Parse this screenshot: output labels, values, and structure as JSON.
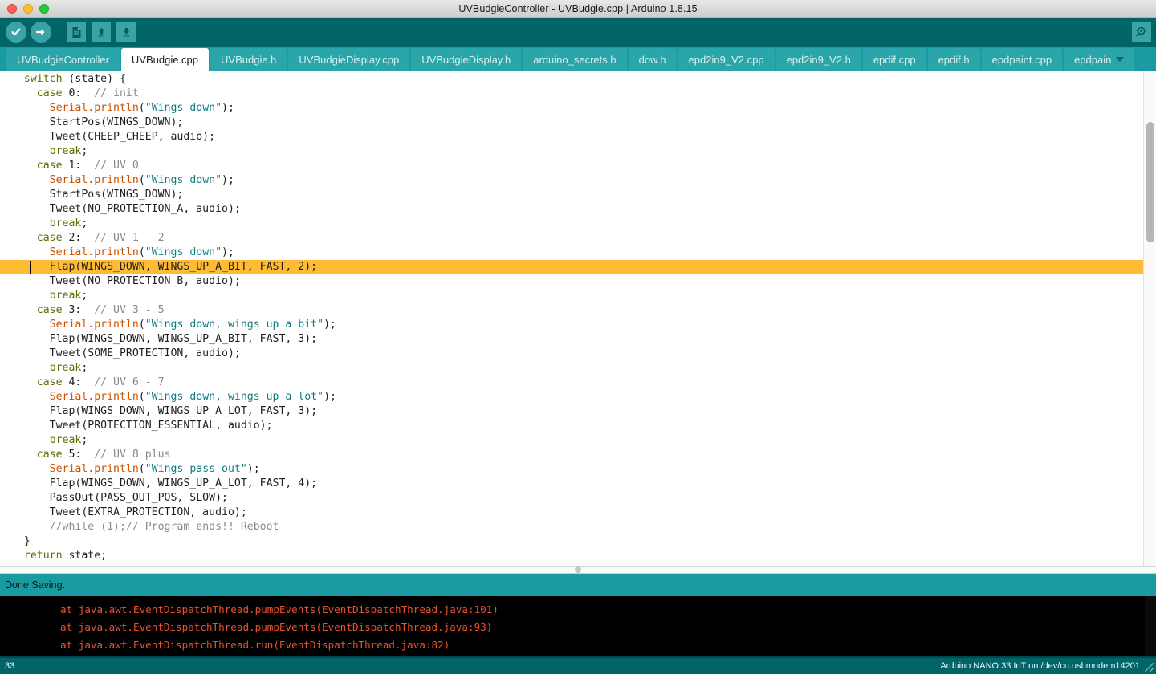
{
  "window": {
    "title": "UVBudgieController - UVBudgie.cpp | Arduino 1.8.15",
    "close_label": "",
    "minimize_label": "",
    "maximize_label": ""
  },
  "toolbar": {
    "verify_label": "Verify",
    "upload_label": "Upload",
    "new_label": "New",
    "open_label": "Open",
    "save_label": "Save",
    "serial_monitor_label": "Serial Monitor"
  },
  "tabs": {
    "active_index": 1,
    "items": [
      {
        "label": "UVBudgieController"
      },
      {
        "label": "UVBudgie.cpp"
      },
      {
        "label": "UVBudgie.h"
      },
      {
        "label": "UVBudgieDisplay.cpp"
      },
      {
        "label": "UVBudgieDisplay.h"
      },
      {
        "label": "arduino_secrets.h"
      },
      {
        "label": "dow.h"
      },
      {
        "label": "epd2in9_V2.cpp"
      },
      {
        "label": "epd2in9_V2.h"
      },
      {
        "label": "epdif.cpp"
      },
      {
        "label": "epdif.h"
      },
      {
        "label": "epdpaint.cpp"
      },
      {
        "label": "epdpain"
      }
    ]
  },
  "editor": {
    "highlighted_line_index": 13,
    "lines": [
      [
        {
          "t": "  ",
          "c": "plain"
        },
        {
          "t": "switch",
          "c": "kw"
        },
        {
          "t": " (state) {",
          "c": "plain"
        }
      ],
      [
        {
          "t": "    ",
          "c": "plain"
        },
        {
          "t": "case",
          "c": "kw"
        },
        {
          "t": " 0:  ",
          "c": "plain"
        },
        {
          "t": "// init",
          "c": "com"
        }
      ],
      [
        {
          "t": "      ",
          "c": "plain"
        },
        {
          "t": "Serial.println",
          "c": "fn"
        },
        {
          "t": "(",
          "c": "plain"
        },
        {
          "t": "\"Wings down\"",
          "c": "str"
        },
        {
          "t": ");",
          "c": "plain"
        }
      ],
      [
        {
          "t": "      StartPos(WINGS_DOWN);",
          "c": "plain"
        }
      ],
      [
        {
          "t": "      Tweet(CHEEP_CHEEP, audio);",
          "c": "plain"
        }
      ],
      [
        {
          "t": "      ",
          "c": "plain"
        },
        {
          "t": "break",
          "c": "kw"
        },
        {
          "t": ";",
          "c": "plain"
        }
      ],
      [
        {
          "t": "    ",
          "c": "plain"
        },
        {
          "t": "case",
          "c": "kw"
        },
        {
          "t": " 1:  ",
          "c": "plain"
        },
        {
          "t": "// UV 0",
          "c": "com"
        }
      ],
      [
        {
          "t": "      ",
          "c": "plain"
        },
        {
          "t": "Serial.println",
          "c": "fn"
        },
        {
          "t": "(",
          "c": "plain"
        },
        {
          "t": "\"Wings down\"",
          "c": "str"
        },
        {
          "t": ");",
          "c": "plain"
        }
      ],
      [
        {
          "t": "      StartPos(WINGS_DOWN);",
          "c": "plain"
        }
      ],
      [
        {
          "t": "      Tweet(NO_PROTECTION_A, audio);",
          "c": "plain"
        }
      ],
      [
        {
          "t": "      ",
          "c": "plain"
        },
        {
          "t": "break",
          "c": "kw"
        },
        {
          "t": ";",
          "c": "plain"
        }
      ],
      [
        {
          "t": "    ",
          "c": "plain"
        },
        {
          "t": "case",
          "c": "kw"
        },
        {
          "t": " 2:  ",
          "c": "plain"
        },
        {
          "t": "// UV 1 - 2",
          "c": "com"
        }
      ],
      [
        {
          "t": "      ",
          "c": "plain"
        },
        {
          "t": "Serial.println",
          "c": "fn"
        },
        {
          "t": "(",
          "c": "plain"
        },
        {
          "t": "\"Wings down\"",
          "c": "str"
        },
        {
          "t": ");",
          "c": "plain"
        }
      ],
      [
        {
          "t": "      Flap(WINGS_DOWN, WINGS_UP_A_BIT, FAST, 2);",
          "c": "plain"
        }
      ],
      [
        {
          "t": "      Tweet(NO_PROTECTION_B, audio);",
          "c": "plain"
        }
      ],
      [
        {
          "t": "      ",
          "c": "plain"
        },
        {
          "t": "break",
          "c": "kw"
        },
        {
          "t": ";",
          "c": "plain"
        }
      ],
      [
        {
          "t": "    ",
          "c": "plain"
        },
        {
          "t": "case",
          "c": "kw"
        },
        {
          "t": " 3:  ",
          "c": "plain"
        },
        {
          "t": "// UV 3 - 5",
          "c": "com"
        }
      ],
      [
        {
          "t": "      ",
          "c": "plain"
        },
        {
          "t": "Serial.println",
          "c": "fn"
        },
        {
          "t": "(",
          "c": "plain"
        },
        {
          "t": "\"Wings down, wings up a bit\"",
          "c": "str"
        },
        {
          "t": ");",
          "c": "plain"
        }
      ],
      [
        {
          "t": "      Flap(WINGS_DOWN, WINGS_UP_A_BIT, FAST, 3);",
          "c": "plain"
        }
      ],
      [
        {
          "t": "      Tweet(SOME_PROTECTION, audio);",
          "c": "plain"
        }
      ],
      [
        {
          "t": "      ",
          "c": "plain"
        },
        {
          "t": "break",
          "c": "kw"
        },
        {
          "t": ";",
          "c": "plain"
        }
      ],
      [
        {
          "t": "    ",
          "c": "plain"
        },
        {
          "t": "case",
          "c": "kw"
        },
        {
          "t": " 4:  ",
          "c": "plain"
        },
        {
          "t": "// UV 6 - 7",
          "c": "com"
        }
      ],
      [
        {
          "t": "      ",
          "c": "plain"
        },
        {
          "t": "Serial.println",
          "c": "fn"
        },
        {
          "t": "(",
          "c": "plain"
        },
        {
          "t": "\"Wings down, wings up a lot\"",
          "c": "str"
        },
        {
          "t": ");",
          "c": "plain"
        }
      ],
      [
        {
          "t": "      Flap(WINGS_DOWN, WINGS_UP_A_LOT, FAST, 3);",
          "c": "plain"
        }
      ],
      [
        {
          "t": "      Tweet(PROTECTION_ESSENTIAL, audio);",
          "c": "plain"
        }
      ],
      [
        {
          "t": "      ",
          "c": "plain"
        },
        {
          "t": "break",
          "c": "kw"
        },
        {
          "t": ";",
          "c": "plain"
        }
      ],
      [
        {
          "t": "    ",
          "c": "plain"
        },
        {
          "t": "case",
          "c": "kw"
        },
        {
          "t": " 5:  ",
          "c": "plain"
        },
        {
          "t": "// UV 8 plus",
          "c": "com"
        }
      ],
      [
        {
          "t": "      ",
          "c": "plain"
        },
        {
          "t": "Serial.println",
          "c": "fn"
        },
        {
          "t": "(",
          "c": "plain"
        },
        {
          "t": "\"Wings pass out\"",
          "c": "str"
        },
        {
          "t": ");",
          "c": "plain"
        }
      ],
      [
        {
          "t": "      Flap(WINGS_DOWN, WINGS_UP_A_LOT, FAST, 4);",
          "c": "plain"
        }
      ],
      [
        {
          "t": "      PassOut(PASS_OUT_POS, SLOW);",
          "c": "plain"
        }
      ],
      [
        {
          "t": "      Tweet(EXTRA_PROTECTION, audio);",
          "c": "plain"
        }
      ],
      [
        {
          "t": "      ",
          "c": "plain"
        },
        {
          "t": "//while (1);// Program ends!! Reboot",
          "c": "com"
        }
      ],
      [
        {
          "t": "  }",
          "c": "plain"
        }
      ],
      [
        {
          "t": "  ",
          "c": "plain"
        },
        {
          "t": "return",
          "c": "kw"
        },
        {
          "t": " state;",
          "c": "plain"
        }
      ]
    ]
  },
  "status": {
    "message": "Done Saving."
  },
  "console": {
    "lines": [
      "at java.awt.EventDispatchThread.pumpEvents(EventDispatchThread.java:101)",
      "at java.awt.EventDispatchThread.pumpEvents(EventDispatchThread.java:93)",
      "at java.awt.EventDispatchThread.run(EventDispatchThread.java:82)"
    ]
  },
  "bottombar": {
    "line_number": "33",
    "board_info": "Arduino NANO 33 IoT on /dev/cu.usbmodem14201"
  },
  "colors": {
    "toolbar_bg": "#006468",
    "tabstrip_bg": "#1a9ba1",
    "accent_teal": "#2aa5aa",
    "highlight": "#ffbb33",
    "console_text": "#e8522d",
    "keyword": "#5e6e00",
    "function": "#cc5200",
    "string": "#0f7e84",
    "comment": "#8b8b8b"
  }
}
